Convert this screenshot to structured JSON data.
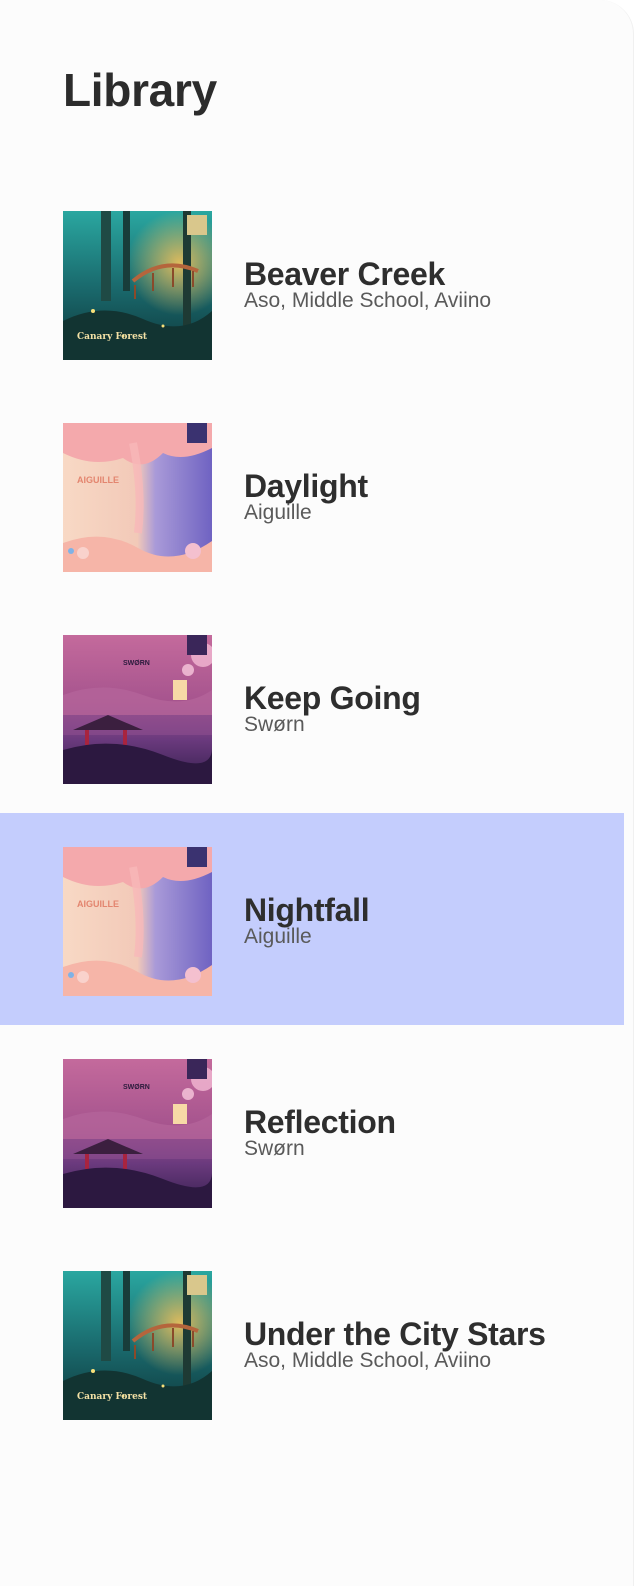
{
  "page": {
    "title": "Library"
  },
  "colors": {
    "selected_row": "#c4cdfd",
    "title_text": "#2c2c2c",
    "subtitle_text": "#5a5a5a"
  },
  "songs": [
    {
      "title": "Beaver Creek",
      "artist": "Aso, Middle School, Aviino",
      "cover": "canary-forest-cover",
      "cover_text": "Canary Forest",
      "selected": false
    },
    {
      "title": "Daylight",
      "artist": "Aiguille",
      "cover": "day-and-night-cover",
      "cover_text": "AIGUILLE",
      "selected": false
    },
    {
      "title": "Keep Going",
      "artist": "Swørn",
      "cover": "lantern-lake-cover",
      "cover_text": "",
      "selected": false
    },
    {
      "title": "Nightfall",
      "artist": "Aiguille",
      "cover": "day-and-night-cover",
      "cover_text": "AIGUILLE",
      "selected": true
    },
    {
      "title": "Reflection",
      "artist": "Swørn",
      "cover": "lantern-lake-cover",
      "cover_text": "",
      "selected": false
    },
    {
      "title": "Under the City Stars",
      "artist": "Aso, Middle School, Aviino",
      "cover": "canary-forest-cover",
      "cover_text": "Canary Forest",
      "selected": false
    }
  ]
}
